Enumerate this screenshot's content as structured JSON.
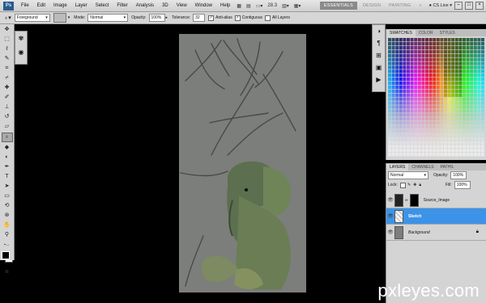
{
  "app": {
    "logo": "Ps",
    "menu": [
      "File",
      "Edit",
      "Image",
      "Layer",
      "Select",
      "Filter",
      "Analysis",
      "3D",
      "View",
      "Window",
      "Help"
    ],
    "zoom": "28.3",
    "workspaces": [
      "ESSENTIALS",
      "DESIGN",
      "PAINTING"
    ],
    "cs_live": "CS Live",
    "window_buttons": [
      "–",
      "□",
      "×"
    ]
  },
  "options": {
    "fill_source": "Foreground",
    "mode_label": "Mode:",
    "mode_value": "Normal",
    "opacity_label": "Opacity:",
    "opacity_value": "100%",
    "tolerance_label": "Tolerance:",
    "tolerance_value": "32",
    "anti_alias": "Anti-alias",
    "contiguous": "Contiguous",
    "all_layers": "All Layers"
  },
  "swatches_panel": {
    "tabs": [
      "SWATCHES",
      "COLOR",
      "STYLES"
    ]
  },
  "layers_panel": {
    "tabs": [
      "LAYERS",
      "CHANNELS",
      "PATHS"
    ],
    "blend_mode": "Normal",
    "opacity_label": "Opacity:",
    "opacity_value": "100%",
    "lock_label": "Lock:",
    "fill_label": "Fill:",
    "fill_value": "100%",
    "layers": [
      {
        "name": "Source_Image",
        "selected": false
      },
      {
        "name": "Sketch",
        "selected": true
      },
      {
        "name": "Background",
        "selected": false
      }
    ]
  },
  "watermark": "pxleyes.com"
}
